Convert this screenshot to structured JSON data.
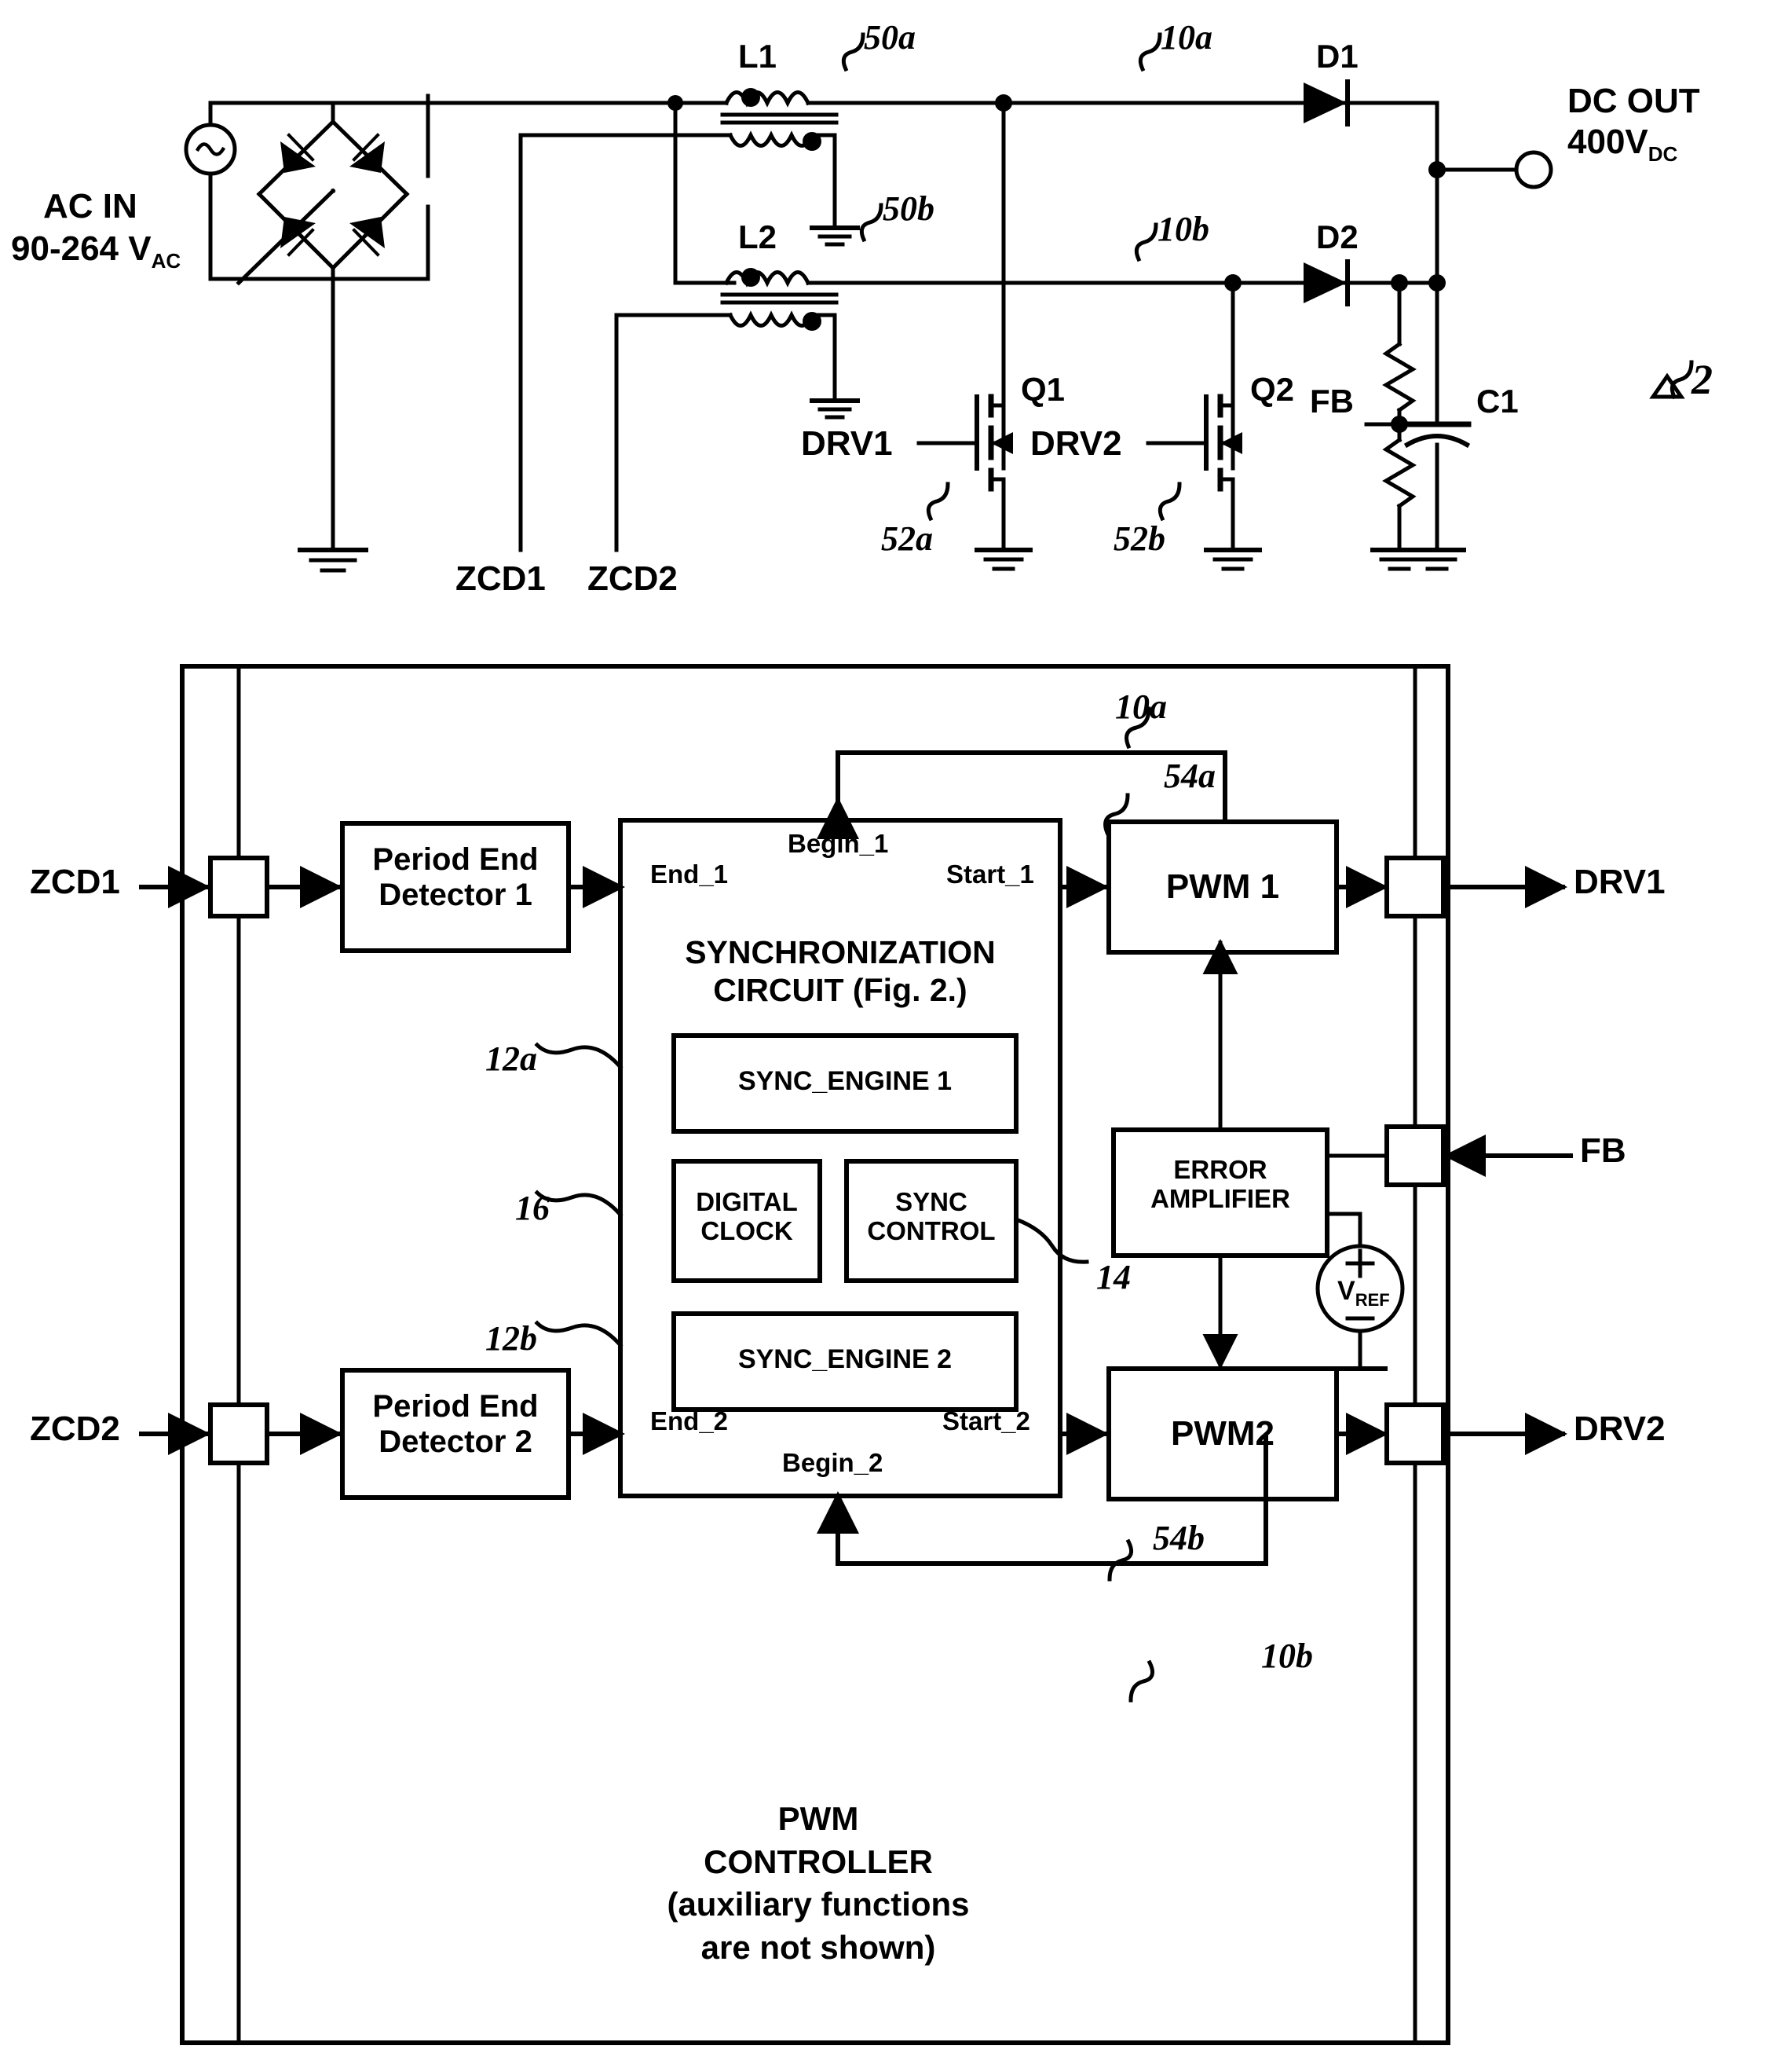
{
  "figure": {
    "reference_marker": "2"
  },
  "power_stage": {
    "ac_in": {
      "line1": "AC IN",
      "line2": "90-264 V",
      "line2_sub": "AC"
    },
    "inductors": [
      {
        "name": "L1",
        "ref": "50a"
      },
      {
        "name": "L2",
        "ref": "50b"
      }
    ],
    "nets": [
      {
        "ref": "10a"
      },
      {
        "ref": "10b"
      }
    ],
    "diodes": [
      {
        "name": "D1"
      },
      {
        "name": "D2"
      }
    ],
    "mosfets": [
      {
        "name": "Q1",
        "drive": "DRV1",
        "ref": "52a"
      },
      {
        "name": "Q2",
        "drive": "DRV2",
        "ref": "52b"
      }
    ],
    "feedback_label": "FB",
    "capacitor": "C1",
    "output": {
      "line1": "DC OUT",
      "line2": "400V",
      "line2_sub": "DC"
    },
    "zcd_taps": [
      "ZCD1",
      "ZCD2"
    ]
  },
  "controller": {
    "title_lines": [
      "PWM",
      "CONTROLLER",
      "(auxiliary functions",
      "are not shown)"
    ],
    "pins_in": [
      "ZCD1",
      "ZCD2",
      "FB"
    ],
    "pins_out": [
      "DRV1",
      "DRV2"
    ],
    "period_end_detectors": [
      {
        "line1": "Period End",
        "line2": "Detector 1"
      },
      {
        "line1": "Period End",
        "line2": "Detector 2"
      }
    ],
    "sync_circuit": {
      "title_line1": "SYNCHRONIZATION",
      "title_line2": "CIRCUIT (Fig. 2.)",
      "ports": {
        "end_1": "End_1",
        "begin_1": "Begin_1",
        "start_1": "Start_1",
        "end_2": "End_2",
        "begin_2": "Begin_2",
        "start_2": "Start_2"
      },
      "blocks": [
        {
          "label": "SYNC_ENGINE 1",
          "ref": "12a"
        },
        {
          "label": "DIGITAL\nCLOCK",
          "line1": "DIGITAL",
          "line2": "CLOCK",
          "ref": "16"
        },
        {
          "label": "SYNC\nCONTROL",
          "line1": "SYNC",
          "line2": "CONTROL",
          "ref": "14"
        },
        {
          "label": "SYNC_ENGINE 2",
          "ref": "12b"
        }
      ]
    },
    "pwm_blocks": [
      {
        "label": "PWM 1",
        "ref": "54a",
        "feedback_ref": "10a"
      },
      {
        "label": "PWM2",
        "ref": "54b",
        "feedback_ref": "10b"
      }
    ],
    "error_amplifier": {
      "line1": "ERROR",
      "line2": "AMPLIFIER"
    },
    "vref": {
      "label": "V",
      "sub": "REF",
      "plus": "+",
      "minus": "−"
    }
  },
  "colors": {
    "ink": "#000000",
    "paper": "#ffffff"
  }
}
